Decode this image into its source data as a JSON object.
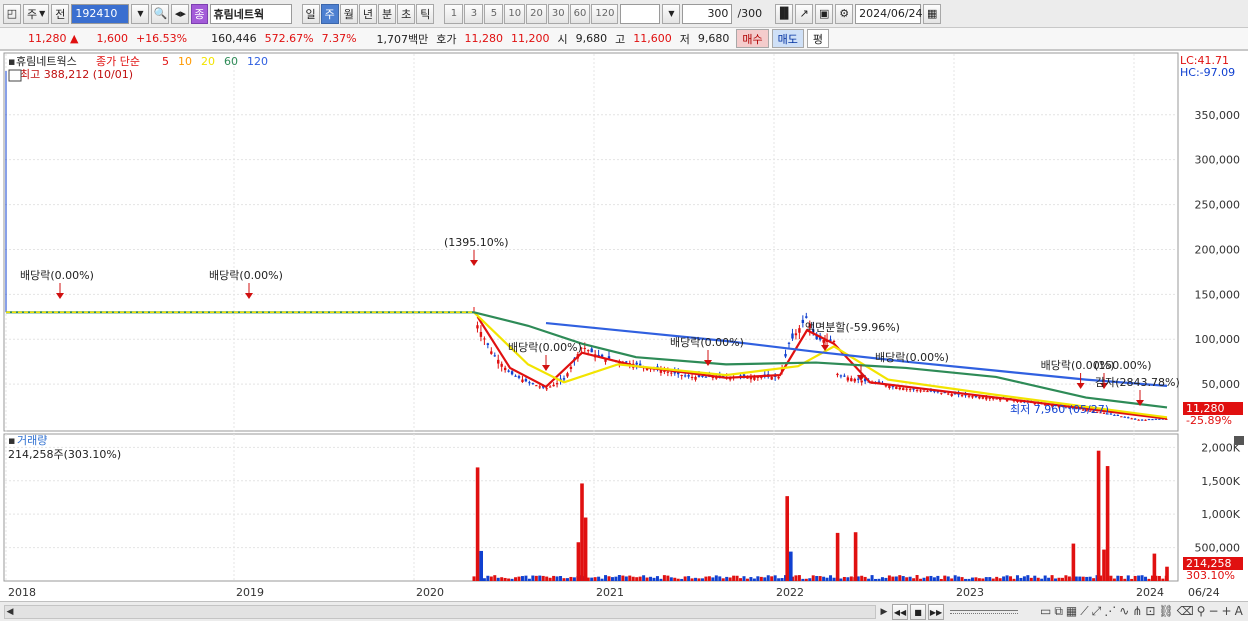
{
  "toolbar": {
    "market_label": "주",
    "prev_label": "전",
    "code": "192410",
    "badge": "종",
    "stock_name": "휴림네트웍",
    "periods": [
      "일",
      "주",
      "월",
      "년",
      "분",
      "초",
      "틱"
    ],
    "selected_period": "주",
    "intervals": [
      "1",
      "3",
      "5",
      "10",
      "20",
      "30",
      "60",
      "120"
    ],
    "count": "300",
    "count_total": "/300",
    "date": "2024/06/24"
  },
  "quote": {
    "price": "11,280",
    "change": "1,600",
    "change_pct": "+16.53%",
    "volume": "160,446",
    "vol_ratio": "572.67%",
    "turnover": "7.37%",
    "amount": "1,707백만",
    "bid_label": "호가",
    "ask": "11,280",
    "bid": "11,200",
    "open_label": "시",
    "open": "9,680",
    "high_label": "고",
    "high": "11,600",
    "low_label": "저",
    "low": "9,680",
    "buy_label": "매수",
    "sell_label": "매도",
    "eval_label": "평"
  },
  "price_panel": {
    "name": "휴림네트웍스",
    "ma_title": "종가 단순",
    "ma_periods": [
      "5",
      "10",
      "20",
      "60",
      "120"
    ],
    "ma_colors": [
      "#e01010",
      "#ff9900",
      "#f2e400",
      "#2e8b57",
      "#3060e0"
    ],
    "high_note": "최고 388,212 (10/01)",
    "lc": "LC:41.71",
    "hc": "HC:-97.09",
    "y_ticks": [
      "350,000",
      "300,000",
      "250,000",
      "200,000",
      "150,000",
      "100,000",
      "50,000"
    ],
    "current_price": "11,280",
    "current_pct": "-25.89%",
    "low_note": "최저 7,960 (05/27)",
    "events": [
      "배당락(0.00%)",
      "배당락(0.00%)",
      "(1395.10%)",
      "배당락(0.00%)",
      "배당락(0.00%)",
      "액면분할(-59.96%)",
      "배당락(0.00%)",
      "배당락(0.00%)",
      "(150.00%)",
      "감자(2843.78%)"
    ]
  },
  "volume_panel": {
    "title": "거래량",
    "value_note": "214,258주(303.10%)",
    "y_ticks": [
      "2,000K",
      "1,500K",
      "1,000K",
      "500,000"
    ],
    "current_volume": "214,258",
    "current_pct": "303.10%"
  },
  "x_axis": {
    "labels": [
      "2018",
      "2019",
      "2020",
      "2021",
      "2022",
      "2023",
      "2024",
      "06/24"
    ]
  },
  "chart_data": {
    "type": "candlestick",
    "title": "휴림네트웍스",
    "x_labels": [
      "2018",
      "2019",
      "2020",
      "2021",
      "2022",
      "2023",
      "2024"
    ],
    "ylim": [
      0,
      400000
    ],
    "price_series": {
      "name": "close",
      "x": [
        2018.0,
        2019.0,
        2020.0,
        2020.6,
        2020.62,
        2020.7,
        2020.8,
        2020.9,
        2021.0,
        2021.1,
        2021.2,
        2021.3,
        2021.5,
        2021.8,
        2022.0,
        2022.3,
        2022.35,
        2022.45,
        2022.5,
        2022.6,
        2022.62,
        2022.8,
        2023.0,
        2023.3,
        2023.6,
        2023.9,
        2024.1,
        2024.3,
        2024.45
      ],
      "values": [
        130000,
        130000,
        130000,
        130000,
        115000,
        85000,
        62000,
        52000,
        45000,
        55000,
        92000,
        80000,
        72000,
        58000,
        58000,
        58000,
        95000,
        125000,
        100000,
        98000,
        60000,
        52000,
        45000,
        38000,
        32000,
        24000,
        18000,
        10000,
        11280
      ]
    },
    "ma_series": [
      {
        "name": "5",
        "x": [
          2020.62,
          2020.8,
          2021.0,
          2021.2,
          2021.5,
          2022.0,
          2022.3,
          2022.45,
          2022.6,
          2022.8,
          2023.5,
          2024.45
        ],
        "values": [
          125000,
          68000,
          47000,
          85000,
          70000,
          57000,
          60000,
          110000,
          95000,
          52000,
          35000,
          11500
        ]
      },
      {
        "name": "20",
        "x": [
          2020.6,
          2020.9,
          2021.1,
          2021.4,
          2022.0,
          2022.4,
          2022.6,
          2022.9,
          2023.5,
          2024.45
        ],
        "values": [
          130000,
          72000,
          52000,
          72000,
          60000,
          70000,
          92000,
          55000,
          38000,
          13000
        ]
      },
      {
        "name": "60",
        "x": [
          2018.0,
          2020.6,
          2020.9,
          2021.2,
          2021.5,
          2022.0,
          2022.5,
          2023.0,
          2023.5,
          2024.0,
          2024.45
        ],
        "values": [
          130000,
          130000,
          115000,
          95000,
          80000,
          72000,
          74000,
          68000,
          58000,
          35000,
          24000
        ]
      },
      {
        "name": "120",
        "x": [
          2021.0,
          2021.5,
          2022.0,
          2022.5,
          2023.0,
          2023.5,
          2024.0,
          2024.45
        ],
        "values": [
          118000,
          108000,
          98000,
          86000,
          75000,
          65000,
          55000,
          48000
        ]
      }
    ],
    "volume_k": [
      {
        "x": 2020.62,
        "v": 1700,
        "up": true
      },
      {
        "x": 2020.64,
        "v": 450,
        "up": false
      },
      {
        "x": 2021.18,
        "v": 580,
        "up": true
      },
      {
        "x": 2021.2,
        "v": 1460,
        "up": true
      },
      {
        "x": 2021.22,
        "v": 950,
        "up": true
      },
      {
        "x": 2022.34,
        "v": 1270,
        "up": true
      },
      {
        "x": 2022.36,
        "v": 440,
        "up": false
      },
      {
        "x": 2022.62,
        "v": 720,
        "up": true
      },
      {
        "x": 2022.72,
        "v": 730,
        "up": true
      },
      {
        "x": 2023.93,
        "v": 560,
        "up": true
      },
      {
        "x": 2024.07,
        "v": 1950,
        "up": true
      },
      {
        "x": 2024.12,
        "v": 1720,
        "up": true
      },
      {
        "x": 2024.1,
        "v": 470,
        "up": true
      },
      {
        "x": 2024.38,
        "v": 410,
        "up": true
      },
      {
        "x": 2024.45,
        "v": 214,
        "up": true
      }
    ]
  }
}
